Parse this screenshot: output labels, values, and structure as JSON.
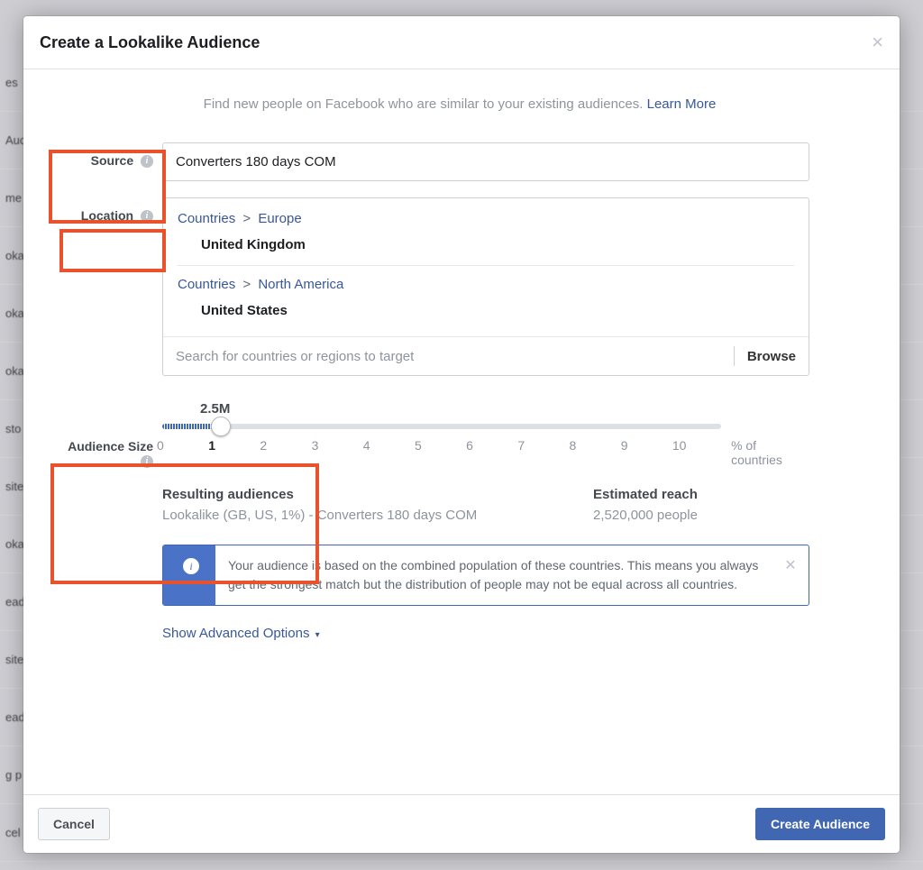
{
  "modal": {
    "title": "Create a Lookalike Audience",
    "intro_text": "Find new people on Facebook who are similar to your existing audiences. ",
    "learn_more": "Learn More"
  },
  "source": {
    "label": "Source",
    "value": "Converters 180 days COM"
  },
  "location": {
    "label": "Location",
    "groups": [
      {
        "crumb1": "Countries",
        "crumb2": "Europe",
        "country": "United Kingdom"
      },
      {
        "crumb1": "Countries",
        "crumb2": "North America",
        "country": "United States"
      }
    ],
    "search_placeholder": "Search for countries or regions to target",
    "browse": "Browse"
  },
  "audience_size": {
    "label": "Audience Size",
    "value_display": "2.5M",
    "ticks": [
      "0",
      "1",
      "2",
      "3",
      "4",
      "5",
      "6",
      "7",
      "8",
      "9",
      "10"
    ],
    "pct_label": "% of countries"
  },
  "results": {
    "left_head": "Resulting audiences",
    "left_val": "Lookalike (GB, US, 1%) - Converters 180 days COM",
    "right_head": "Estimated reach",
    "right_val": "2,520,000 people"
  },
  "info_banner": "Your audience is based on the combined population of these countries. This means you always get the strongest match but the distribution of people may not be equal across all countries.",
  "advanced": "Show Advanced Options",
  "footer": {
    "cancel": "Cancel",
    "create": "Create Audience"
  },
  "chart_data": {
    "type": "bar",
    "title": "Audience Size Slider",
    "xlabel": "% of countries",
    "ylabel": "",
    "categories": [
      "0",
      "1",
      "2",
      "3",
      "4",
      "5",
      "6",
      "7",
      "8",
      "9",
      "10"
    ],
    "selected_value": 1,
    "display_label": "2.5M",
    "xlim": [
      0,
      10
    ]
  }
}
